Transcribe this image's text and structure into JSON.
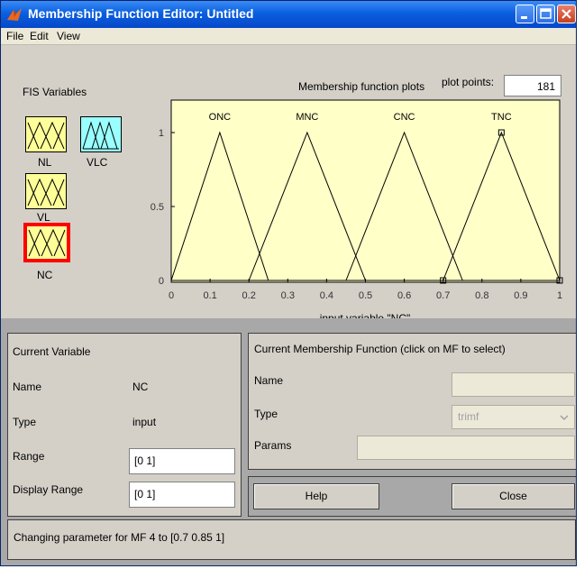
{
  "window": {
    "title": "Membership Function Editor: Untitled"
  },
  "menu": {
    "file": "File",
    "edit": "Edit",
    "view": "View"
  },
  "fis": {
    "header": "FIS Variables",
    "variables": [
      {
        "label": "NL"
      },
      {
        "label": "VLC"
      },
      {
        "label": "VL"
      },
      {
        "label": "NC"
      }
    ]
  },
  "plot": {
    "header": "Membership function plots",
    "points_label": "plot points:",
    "points_value": "181",
    "xlabel": "input variable \"NC\"",
    "background": "#ffffc8"
  },
  "chart_data": {
    "type": "line",
    "xlim": [
      0,
      1
    ],
    "ylim": [
      0,
      1
    ],
    "xticks": [
      0,
      0.1,
      0.2,
      0.3,
      0.4,
      0.5,
      0.6,
      0.7,
      0.8,
      0.9,
      1
    ],
    "xtick_labels": [
      "0",
      "0.1",
      "0.2",
      "0.3",
      "0.4",
      "0.5",
      "0.6",
      "0.7",
      "0.8",
      "0.9",
      "1"
    ],
    "yticks": [
      0,
      0.5,
      1
    ],
    "ytick_labels": [
      "0",
      "0.5",
      "1"
    ],
    "series": [
      {
        "name": "ONC",
        "params": [
          0,
          0.125,
          0.25
        ]
      },
      {
        "name": "MNC",
        "params": [
          0.2,
          0.35,
          0.5
        ]
      },
      {
        "name": "CNC",
        "params": [
          0.45,
          0.6,
          0.75
        ]
      },
      {
        "name": "TNC",
        "params": [
          0.7,
          0.85,
          1
        ],
        "selected": true
      }
    ]
  },
  "current_variable": {
    "header": "Current Variable",
    "name_label": "Name",
    "name_value": "NC",
    "type_label": "Type",
    "type_value": "input",
    "range_label": "Range",
    "range_value": "[0 1]",
    "display_range_label": "Display Range",
    "display_range_value": "[0 1]"
  },
  "current_mf": {
    "header": "Current Membership Function (click on MF to select)",
    "name_label": "Name",
    "name_value": "",
    "type_label": "Type",
    "type_value": "trimf",
    "params_label": "Params",
    "params_value": ""
  },
  "buttons": {
    "help": "Help",
    "close": "Close"
  },
  "status": {
    "text": "Changing parameter for MF 4 to  [0.7 0.85 1]"
  },
  "colors": {
    "selected_border": "#ff0000",
    "var_input": "#ffff99",
    "var_output": "#99ffff"
  }
}
